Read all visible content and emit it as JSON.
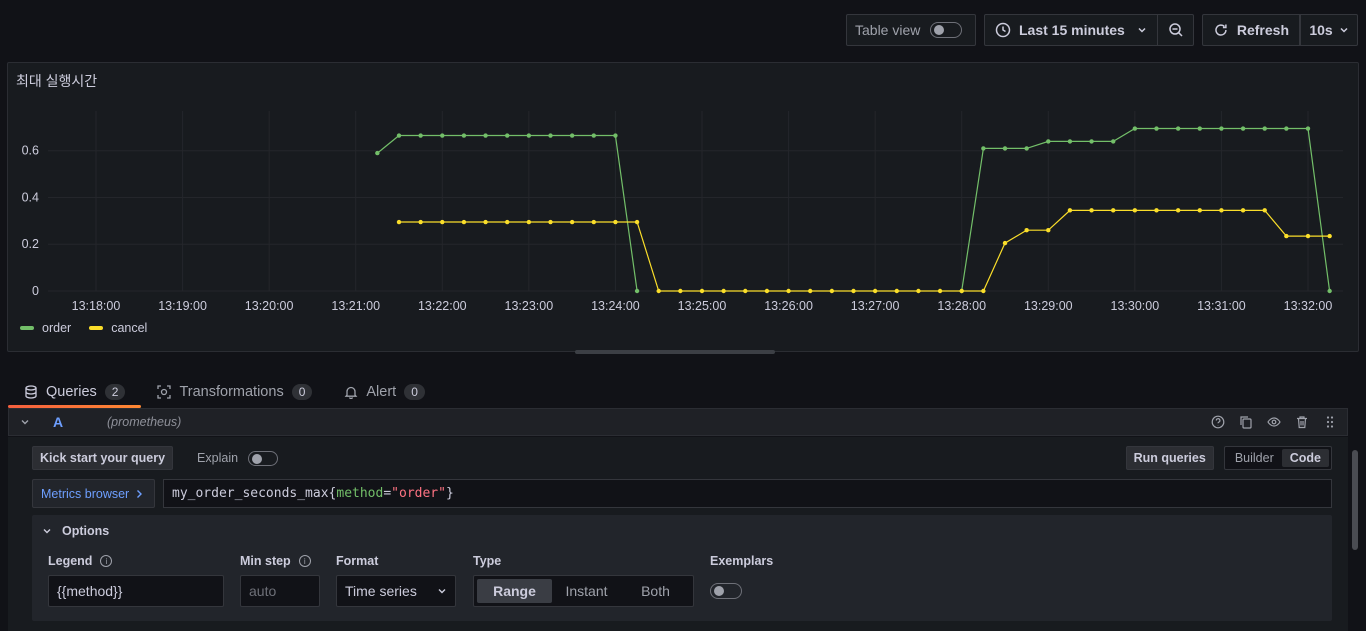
{
  "toolbar": {
    "table_view_label": "Table view",
    "time_range_label": "Last 15 minutes",
    "refresh_label": "Refresh",
    "refresh_interval": "10s"
  },
  "panel": {
    "title": "최대 실행시간"
  },
  "chart_data": {
    "type": "line",
    "x": [
      "13:21:15",
      "13:21:30",
      "13:21:45",
      "13:22:00",
      "13:22:15",
      "13:22:30",
      "13:22:45",
      "13:23:00",
      "13:23:15",
      "13:23:30",
      "13:23:45",
      "13:24:00",
      "13:24:15",
      "13:24:30",
      "13:24:45",
      "13:25:00",
      "13:25:15",
      "13:25:30",
      "13:25:45",
      "13:26:00",
      "13:26:15",
      "13:26:30",
      "13:26:45",
      "13:27:00",
      "13:27:15",
      "13:27:30",
      "13:27:45",
      "13:28:00",
      "13:28:15",
      "13:28:30",
      "13:28:45",
      "13:29:00",
      "13:29:15",
      "13:29:30",
      "13:29:45",
      "13:30:00",
      "13:30:15",
      "13:30:30",
      "13:30:45",
      "13:31:00",
      "13:31:15",
      "13:31:30",
      "13:31:45",
      "13:32:00",
      "13:32:15"
    ],
    "x_ticks": [
      "13:18:00",
      "13:19:00",
      "13:20:00",
      "13:21:00",
      "13:22:00",
      "13:23:00",
      "13:24:00",
      "13:25:00",
      "13:26:00",
      "13:27:00",
      "13:28:00",
      "13:29:00",
      "13:30:00",
      "13:31:00",
      "13:32:00"
    ],
    "y_ticks": [
      "0",
      "0.2",
      "0.4",
      "0.6"
    ],
    "ylim": [
      0,
      0.77
    ],
    "series": [
      {
        "name": "order",
        "color": "#73bf69",
        "values": [
          0.59,
          0.665,
          0.665,
          0.665,
          0.665,
          0.665,
          0.665,
          0.665,
          0.665,
          0.665,
          0.665,
          0.665,
          0,
          null,
          null,
          null,
          null,
          null,
          null,
          null,
          null,
          null,
          null,
          null,
          null,
          null,
          null,
          0,
          0.61,
          0.61,
          0.61,
          0.64,
          0.64,
          0.64,
          0.64,
          0.695,
          0.695,
          0.695,
          0.695,
          0.695,
          0.695,
          0.695,
          0.695,
          0.695,
          0
        ]
      },
      {
        "name": "cancel",
        "color": "#fade2a",
        "values": [
          null,
          0.295,
          0.295,
          0.295,
          0.295,
          0.295,
          0.295,
          0.295,
          0.295,
          0.295,
          0.295,
          0.295,
          0.295,
          0,
          0,
          0,
          0,
          0,
          0,
          0,
          0,
          0,
          0,
          0,
          0,
          0,
          0,
          0,
          0,
          0.205,
          0.26,
          0.26,
          0.345,
          0.345,
          0.345,
          0.345,
          0.345,
          0.345,
          0.345,
          0.345,
          0.345,
          0.345,
          0.235,
          0.235,
          0.235
        ]
      }
    ],
    "grid": true,
    "legend": "bottom-left"
  },
  "tabs": [
    {
      "label": "Queries",
      "count": "2"
    },
    {
      "label": "Transformations",
      "count": "0"
    },
    {
      "label": "Alert",
      "count": "0"
    }
  ],
  "query": {
    "ref_id": "A",
    "datasource": "(prometheus)",
    "kick_start_label": "Kick start your query",
    "explain_label": "Explain",
    "run_label": "Run queries",
    "mode_builder": "Builder",
    "mode_code": "Code",
    "metrics_browser_label": "Metrics browser",
    "expr_metric": "my_order_seconds_max",
    "expr_open": "{",
    "expr_label": "method",
    "expr_eq": "=",
    "expr_value": "\"order\"",
    "expr_close": "}"
  },
  "options": {
    "header": "Options",
    "legend_label": "Legend",
    "legend_value": "{{method}}",
    "min_step_label": "Min step",
    "min_step_placeholder": "auto",
    "format_label": "Format",
    "format_value": "Time series",
    "type_label": "Type",
    "type_range": "Range",
    "type_instant": "Instant",
    "type_both": "Both",
    "exemplars_label": "Exemplars"
  }
}
